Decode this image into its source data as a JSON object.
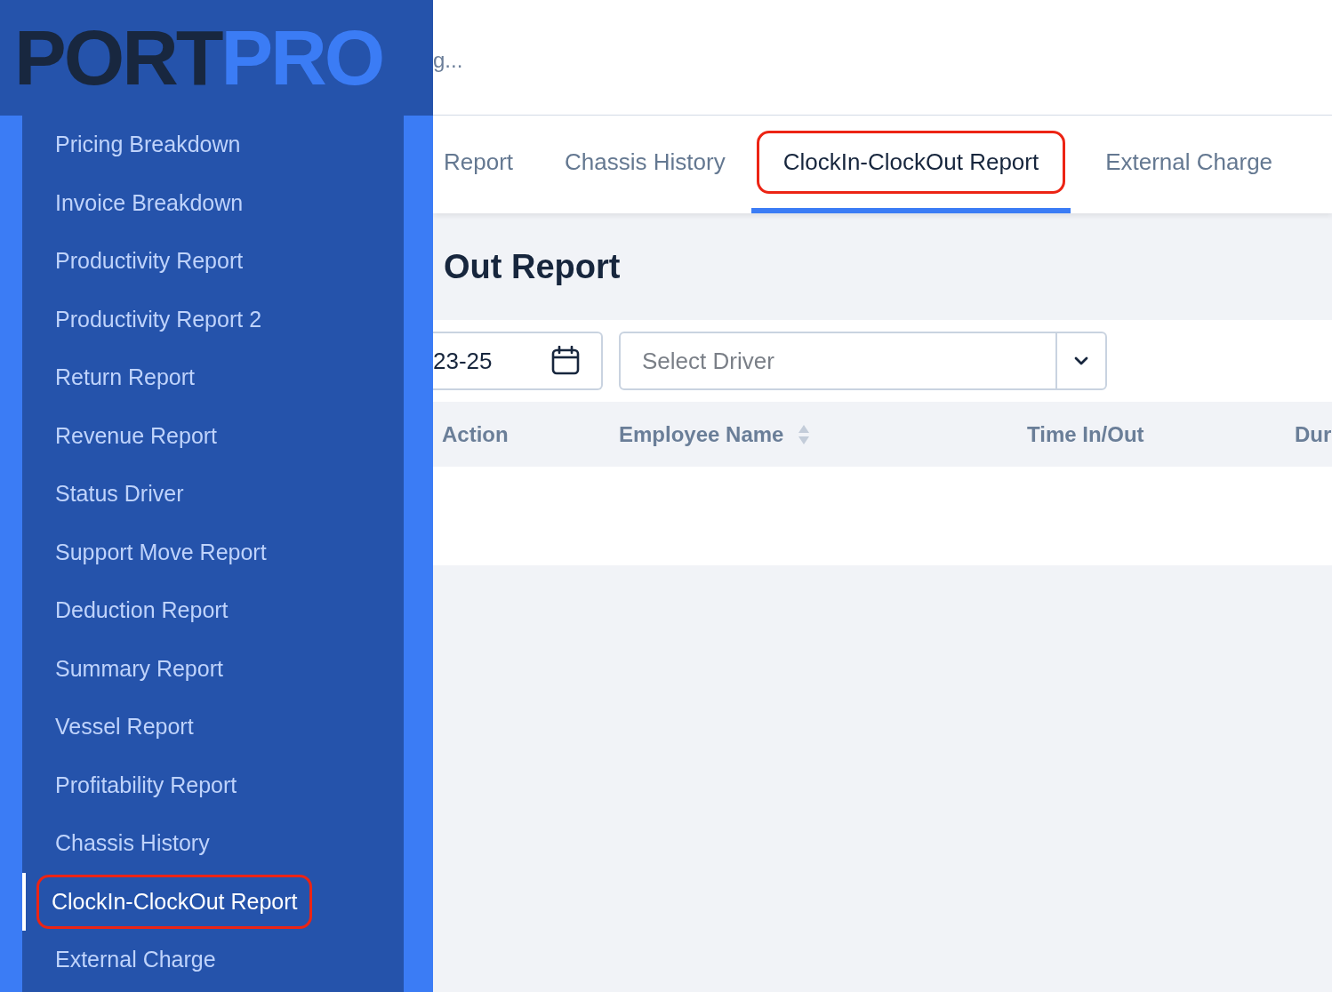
{
  "logo": {
    "dark": "PORT",
    "accent": "PRO"
  },
  "sidebar": {
    "items": [
      {
        "label": "Pricing Breakdown",
        "selected": false,
        "highlighted": false
      },
      {
        "label": "Invoice Breakdown",
        "selected": false,
        "highlighted": false
      },
      {
        "label": "Productivity Report",
        "selected": false,
        "highlighted": false
      },
      {
        "label": "Productivity Report 2",
        "selected": false,
        "highlighted": false
      },
      {
        "label": "Return Report",
        "selected": false,
        "highlighted": false
      },
      {
        "label": "Revenue Report",
        "selected": false,
        "highlighted": false
      },
      {
        "label": "Status Driver",
        "selected": false,
        "highlighted": false
      },
      {
        "label": "Support Move Report",
        "selected": false,
        "highlighted": false
      },
      {
        "label": "Deduction Report",
        "selected": false,
        "highlighted": false
      },
      {
        "label": "Summary Report",
        "selected": false,
        "highlighted": false
      },
      {
        "label": "Vessel Report",
        "selected": false,
        "highlighted": false
      },
      {
        "label": "Profitability Report",
        "selected": false,
        "highlighted": false
      },
      {
        "label": "Chassis History",
        "selected": false,
        "highlighted": false
      },
      {
        "label": "ClockIn-ClockOut Report",
        "selected": true,
        "highlighted": true
      },
      {
        "label": "External Charge",
        "selected": false,
        "highlighted": false
      }
    ]
  },
  "top_bar": {
    "text": "g..."
  },
  "tabs": [
    {
      "label": "Report",
      "selected": false,
      "highlighted": false
    },
    {
      "label": "Chassis History",
      "selected": false,
      "highlighted": false
    },
    {
      "label": "ClockIn-ClockOut Report",
      "selected": true,
      "highlighted": true
    },
    {
      "label": "External Charge",
      "selected": false,
      "highlighted": false
    }
  ],
  "page_title": "Out Report",
  "filters": {
    "date_value": "23-25",
    "driver_placeholder": "Select Driver"
  },
  "table": {
    "columns": [
      {
        "label": "Action",
        "sortable": false
      },
      {
        "label": "Employee Name",
        "sortable": true
      },
      {
        "label": "Time In/Out",
        "sortable": false
      },
      {
        "label": "Dur"
      }
    ]
  }
}
